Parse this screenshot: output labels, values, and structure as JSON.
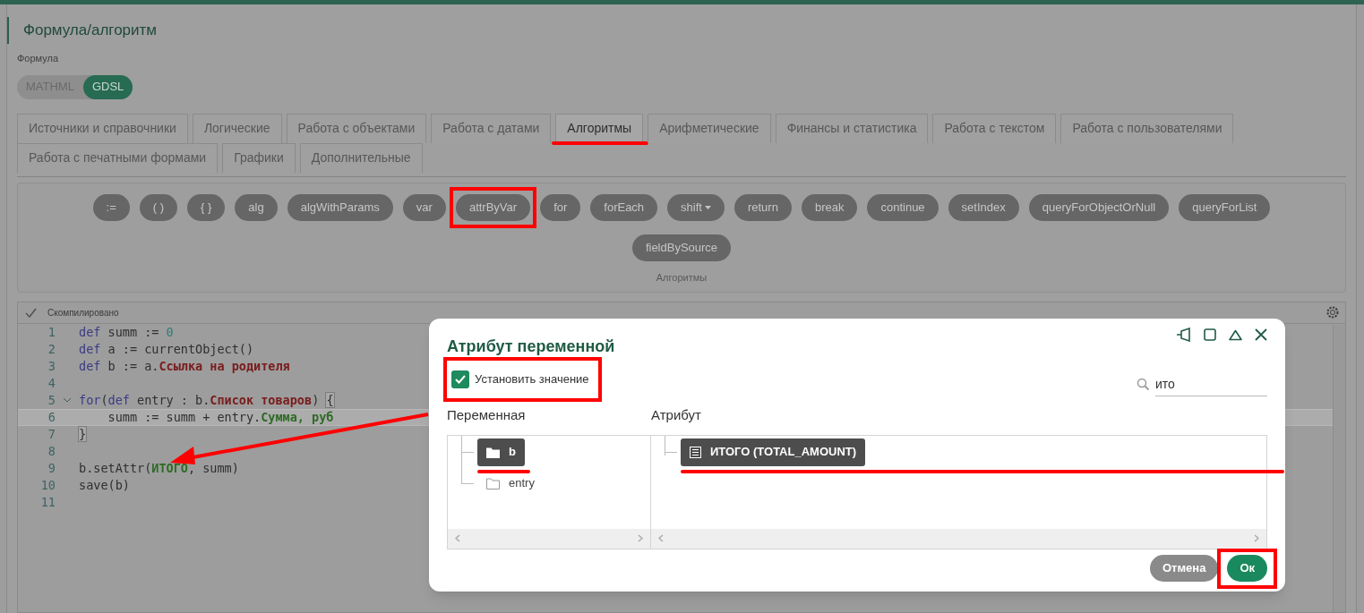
{
  "page": {
    "title": "Формула/алгоритм",
    "formula_label": "Формула"
  },
  "mode_toggle": [
    {
      "label": "MATHML",
      "selected": false
    },
    {
      "label": "GDSL",
      "selected": true
    }
  ],
  "tab_rows": [
    {
      "tabs": [
        {
          "label": "Источники и справочники",
          "selected": false,
          "marked": false
        },
        {
          "label": "Логические",
          "selected": false,
          "marked": false
        },
        {
          "label": "Работа с объектами",
          "selected": false,
          "marked": false
        },
        {
          "label": "Работа с датами",
          "selected": false,
          "marked": false
        },
        {
          "label": "Алгоритмы",
          "selected": true,
          "marked": true
        },
        {
          "label": "Арифметические",
          "selected": false,
          "marked": false
        },
        {
          "label": "Финансы и статистика",
          "selected": false,
          "marked": false
        },
        {
          "label": "Работа с текстом",
          "selected": false,
          "marked": false
        },
        {
          "label": "Работа с пользователями",
          "selected": false,
          "marked": false
        }
      ]
    },
    {
      "tabs": [
        {
          "label": "Работа с печатными формами",
          "selected": false,
          "marked": false
        },
        {
          "label": "Графики",
          "selected": false,
          "marked": false
        },
        {
          "label": "Дополнительные",
          "selected": false,
          "marked": false
        }
      ]
    }
  ],
  "functions": {
    "caption": "Алгоритмы",
    "buttons": [
      {
        "label": ":=",
        "kind": "plain",
        "marked": false
      },
      {
        "label": "( )",
        "kind": "plain",
        "marked": false
      },
      {
        "label": "{ }",
        "kind": "plain",
        "marked": false
      },
      {
        "label": "alg",
        "kind": "plain",
        "marked": false
      },
      {
        "label": "algWithParams",
        "kind": "plain",
        "marked": false
      },
      {
        "label": "var",
        "kind": "plain",
        "marked": false
      },
      {
        "label": "attrByVar",
        "kind": "plain",
        "marked": true
      },
      {
        "label": "for",
        "kind": "plain",
        "marked": false
      },
      {
        "label": "forEach",
        "kind": "plain",
        "marked": false
      },
      {
        "label": "shift",
        "kind": "dropdown",
        "marked": false
      },
      {
        "label": "return",
        "kind": "plain",
        "marked": false
      },
      {
        "label": "break",
        "kind": "plain",
        "marked": false
      },
      {
        "label": "continue",
        "kind": "plain",
        "marked": false
      },
      {
        "label": "setIndex",
        "kind": "plain",
        "marked": false
      },
      {
        "label": "queryForObjectOrNull",
        "kind": "plain",
        "marked": false
      },
      {
        "label": "queryForList",
        "kind": "plain",
        "marked": false
      },
      {
        "label": "fieldBySource",
        "kind": "plain",
        "marked": false
      }
    ]
  },
  "editor": {
    "status": "Скомпилировано",
    "lines": [
      {
        "number": "1",
        "foldable": false,
        "current": false,
        "tokens": [
          {
            "kind": "kw",
            "text": "def"
          },
          {
            "kind": "plain",
            "text": " summ := "
          },
          {
            "kind": "num",
            "text": "0"
          }
        ]
      },
      {
        "number": "2",
        "foldable": false,
        "current": false,
        "tokens": [
          {
            "kind": "kw",
            "text": "def"
          },
          {
            "kind": "plain",
            "text": " a := currentObject()"
          }
        ]
      },
      {
        "number": "3",
        "foldable": false,
        "current": false,
        "tokens": [
          {
            "kind": "kw",
            "text": "def"
          },
          {
            "kind": "plain",
            "text": " b := a."
          },
          {
            "kind": "attr",
            "text": "Ссылка на родителя"
          }
        ]
      },
      {
        "number": "4",
        "foldable": false,
        "current": false
      },
      {
        "number": "5",
        "foldable": true,
        "current": false,
        "tokens": [
          {
            "kind": "kw",
            "text": "for"
          },
          {
            "kind": "plain",
            "text": "("
          },
          {
            "kind": "kw",
            "text": "def"
          },
          {
            "kind": "plain",
            "text": " entry : b."
          },
          {
            "kind": "attr",
            "text": "Список товаров"
          },
          {
            "kind": "plain",
            "text": ") "
          },
          {
            "kind": "match",
            "text": "{"
          }
        ]
      },
      {
        "number": "6",
        "foldable": false,
        "current": true,
        "tokens": [
          {
            "kind": "plain",
            "text": "    summ := summ + entry."
          },
          {
            "kind": "value",
            "text": "Сумма, руб"
          }
        ]
      },
      {
        "number": "7",
        "foldable": false,
        "current": false,
        "tokens": [
          {
            "kind": "match",
            "text": "}"
          }
        ]
      },
      {
        "number": "8",
        "foldable": false,
        "current": false
      },
      {
        "number": "9",
        "foldable": false,
        "current": false,
        "tokens": [
          {
            "kind": "plain",
            "text": "b.setAttr("
          },
          {
            "kind": "value",
            "text": "ИТОГО"
          },
          {
            "kind": "plain",
            "text": ", summ)"
          }
        ]
      },
      {
        "number": "10",
        "foldable": false,
        "current": false,
        "tokens": [
          {
            "kind": "plain",
            "text": "save(b)"
          }
        ]
      },
      {
        "number": "11",
        "foldable": false,
        "current": false
      }
    ]
  },
  "dialog": {
    "title": "Атрибут переменной",
    "set_value": {
      "label": "Установить значение",
      "checked": true,
      "marked": true
    },
    "search": {
      "value": "ито"
    },
    "variable_label": "Переменная",
    "attribute_label": "Атрибут",
    "variables": [
      {
        "name": "b",
        "selected": true,
        "marked": true
      },
      {
        "name": "entry",
        "selected": false,
        "marked": false
      }
    ],
    "attributes": [
      {
        "name": "ИТОГО (TOTAL_AMOUNT)",
        "selected": true,
        "marked": true
      }
    ],
    "buttons": [
      {
        "label": "Отмена",
        "kind": "secondary",
        "marked": false
      },
      {
        "label": "Ок",
        "kind": "primary",
        "marked": true
      }
    ]
  }
}
